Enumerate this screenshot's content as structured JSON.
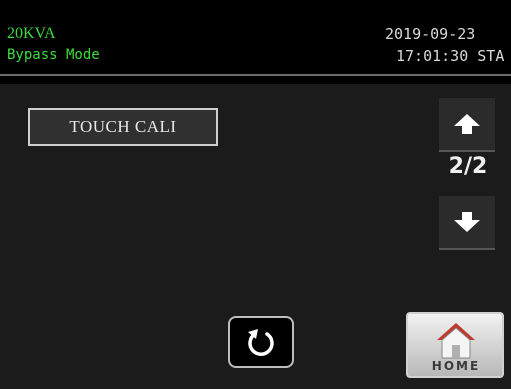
{
  "header": {
    "device": "20KVA",
    "mode": "Bypass Mode",
    "date": "2019-09-23",
    "time": "17:01:30 STA"
  },
  "main": {
    "option": "TOUCH CALI",
    "page_indicator": "2/2",
    "home_label": "HOME"
  },
  "colors": {
    "status_text": "#3ddc3d",
    "clock_text": "#d9d9d9",
    "panel_bg": "#1b1b1b",
    "home_roof": "#c0392b"
  },
  "icons": {
    "up": "arrow-up-icon",
    "down": "arrow-down-icon",
    "back": "rotate-back-icon",
    "home": "house-icon"
  }
}
